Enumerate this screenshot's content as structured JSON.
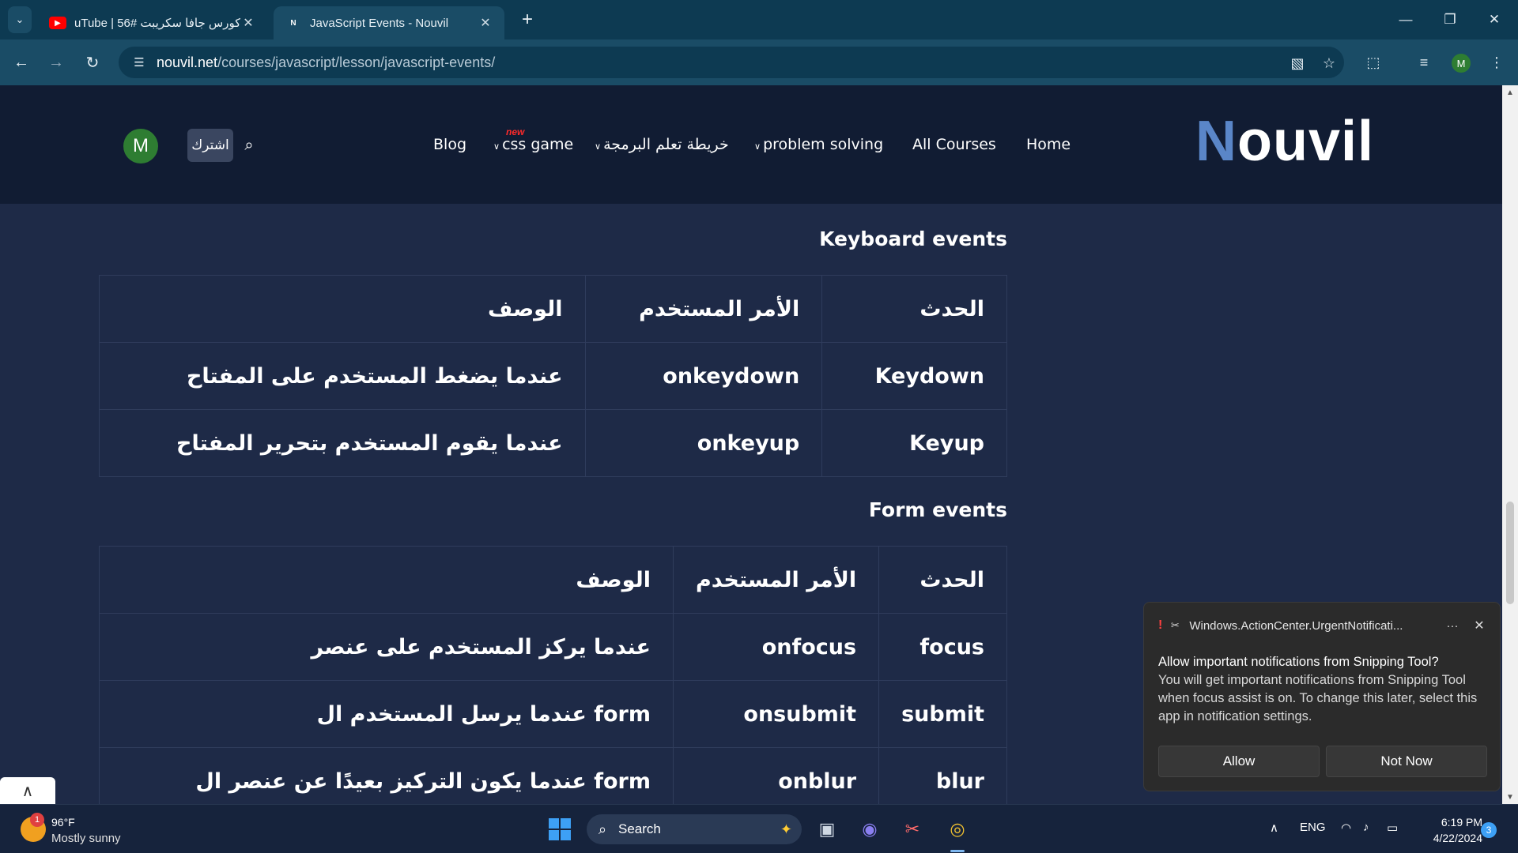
{
  "browser": {
    "tabs": [
      {
        "title": "uTube | كورس جافا سكريبت #56",
        "favicon": "youtube-icon",
        "active": false
      },
      {
        "title": "JavaScript Events - Nouvil",
        "favicon": "N",
        "active": true
      }
    ],
    "new_tab": "+",
    "url_host": "nouvil.net",
    "url_path": "/courses/javascript/lesson/javascript-events/",
    "profile_initial": "M"
  },
  "site": {
    "logo_first": "N",
    "logo_rest": "ouvil",
    "nav": {
      "home": "Home",
      "all_courses": "All Courses",
      "problem_solving": "problem solving",
      "roadmap": "خريطة تعلم البرمجة",
      "css_game": "css game",
      "new_badge": "new",
      "blog": "Blog"
    },
    "subscribe": "اشترك",
    "avatar_initial": "M"
  },
  "keyboard": {
    "title": "Keyboard events",
    "headers": {
      "event": "الحدث",
      "command": "الأمر المستخدم",
      "description": "الوصف"
    },
    "rows": [
      {
        "event": "Keydown",
        "command": "onkeydown",
        "description": "عندما يضغط المستخدم على المفتاح"
      },
      {
        "event": "Keyup",
        "command": "onkeyup",
        "description": "عندما يقوم المستخدم بتحرير المفتاح"
      }
    ]
  },
  "form": {
    "title": "Form events",
    "headers": {
      "event": "الحدث",
      "command": "الأمر المستخدم",
      "description": "الوصف"
    },
    "rows": [
      {
        "event": "focus",
        "command": "onfocus",
        "description": "عندما يركز المستخدم على عنصر"
      },
      {
        "event": "submit",
        "command": "onsubmit",
        "description": "عندما يرسل المستخدم ال form"
      },
      {
        "event": "blur",
        "command": "onblur",
        "description": "عندما يكون التركيز بعيدًا عن عنصر ال form"
      }
    ]
  },
  "notification": {
    "app_name": "Windows.ActionCenter.UrgentNotificati...",
    "more": "···",
    "heading": "Allow important notifications from Snipping Tool?",
    "message": "You will get important notifications from Snipping Tool when focus assist is on. To change this later, select this app in notification settings.",
    "allow": "Allow",
    "not_now": "Not Now"
  },
  "taskbar": {
    "weather_temp": "96°F",
    "weather_desc": "Mostly sunny",
    "weather_badge": "1",
    "search": "Search",
    "language": "ENG",
    "time": "6:19 PM",
    "date": "4/22/2024",
    "notification_count": "3"
  },
  "colors": {
    "page_bg": "#1e2a47",
    "header_bg": "#111c33",
    "logo_accent": "#5a86c8",
    "new_badge": "#ff2a2a",
    "browser_frame": "#0d3a52"
  }
}
